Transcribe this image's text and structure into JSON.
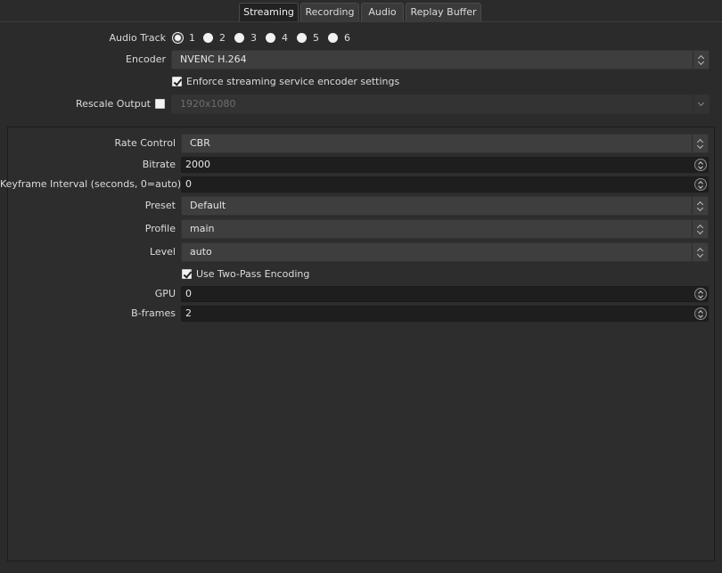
{
  "tabs": [
    {
      "label": "Streaming",
      "active": true
    },
    {
      "label": "Recording",
      "active": false
    },
    {
      "label": "Audio",
      "active": false
    },
    {
      "label": "Replay Buffer",
      "active": false
    }
  ],
  "audio_track": {
    "label": "Audio Track",
    "options": [
      "1",
      "2",
      "3",
      "4",
      "5",
      "6"
    ],
    "selected": "1"
  },
  "encoder": {
    "label": "Encoder",
    "value": "NVENC H.264"
  },
  "enforce": {
    "label": "Enforce streaming service encoder settings",
    "checked": true
  },
  "rescale": {
    "label": "Rescale Output",
    "checked": false,
    "value": "1920x1080"
  },
  "settings": {
    "rate_control": {
      "label": "Rate Control",
      "value": "CBR"
    },
    "bitrate": {
      "label": "Bitrate",
      "value": "2000"
    },
    "keyframe": {
      "label": "Keyframe Interval (seconds, 0=auto)",
      "value": "0"
    },
    "preset": {
      "label": "Preset",
      "value": "Default"
    },
    "profile": {
      "label": "Profile",
      "value": "main"
    },
    "level": {
      "label": "Level",
      "value": "auto"
    },
    "two_pass": {
      "label": "Use Two-Pass Encoding",
      "checked": true
    },
    "gpu": {
      "label": "GPU",
      "value": "0"
    },
    "bframes": {
      "label": "B-frames",
      "value": "2"
    }
  },
  "colors": {
    "background": "#2b2b2b",
    "panel": "#2d2d2d",
    "field": "#3e3e3e",
    "spin": "#1e1e1e",
    "active_tab": "#222222"
  }
}
